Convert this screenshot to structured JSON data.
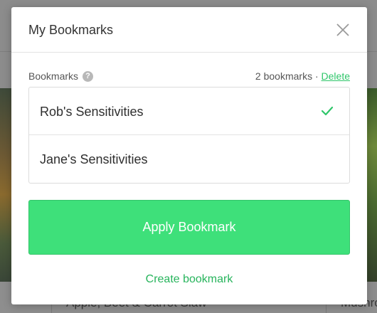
{
  "modal": {
    "title": "My Bookmarks",
    "section_label": "Bookmarks",
    "help_icon_glyph": "?",
    "count_text": "2 bookmarks",
    "separator": "·",
    "delete_label": "Delete",
    "bookmarks": [
      {
        "label": "Rob's Sensitivities",
        "selected": true
      },
      {
        "label": "Jane's Sensitivities",
        "selected": false
      }
    ],
    "apply_label": "Apply Bookmark",
    "create_label": "Create bookmark"
  },
  "background": {
    "card_titles": [
      "Apple, Beet & Carrot Slaw",
      "Mushro"
    ]
  },
  "colors": {
    "accent": "#3ee07a",
    "link": "#2fc66a",
    "check": "#2fc66a"
  },
  "icons": {
    "close": "close-icon",
    "help": "help-icon",
    "check": "check-icon"
  }
}
